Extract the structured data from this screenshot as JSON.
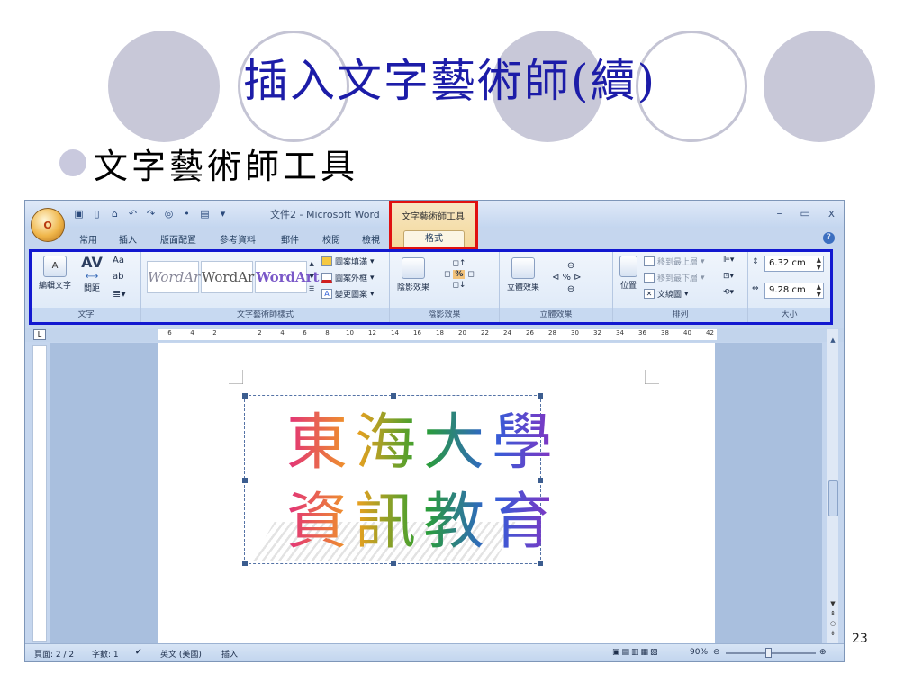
{
  "slide": {
    "title": "插入文字藝術師(續)",
    "bullet": "文字藝術師工具",
    "page_number": "23"
  },
  "window": {
    "doc_title": "文件2 - Microsoft Word",
    "context_group_title": "文字藝術師工具",
    "controls": {
      "minimize": "–",
      "maximize": "▭",
      "close": "x"
    },
    "office_button": "O"
  },
  "tabs": [
    "常用",
    "插入",
    "版面配置",
    "參考資料",
    "郵件",
    "校閱",
    "檢視"
  ],
  "active_tab": "格式",
  "ribbon": {
    "text_group": {
      "label": "文字",
      "edit_text": "編輯文字",
      "spacing": "間距",
      "av_icon": "AV",
      "aa_icon": "Aa",
      "ab_icon": "ab"
    },
    "styles_group": {
      "label": "文字藝術師樣式",
      "samples": [
        "WordArt",
        "WordArt",
        "WordArt"
      ],
      "fill": "圖案填滿",
      "outline": "圖案外框",
      "change_shape": "變更圖案"
    },
    "shadow_group": {
      "label": "陰影效果",
      "button": "陰影效果"
    },
    "threed_group": {
      "label": "立體效果",
      "button": "立體效果"
    },
    "arrange_group": {
      "label": "排列",
      "position": "位置",
      "bring_front": "移到最上層",
      "send_back": "移到最下層",
      "wrap": "文繞圖"
    },
    "size_group": {
      "label": "大小",
      "height": "6.32 cm",
      "width": "9.28 cm"
    }
  },
  "ruler_ticks": [
    "6",
    "4",
    "2",
    "",
    "2",
    "4",
    "6",
    "8",
    "10",
    "12",
    "14",
    "16",
    "18",
    "20",
    "22",
    "24",
    "26",
    "28",
    "30",
    "32",
    "34",
    "36",
    "38",
    "40",
    "42"
  ],
  "wordart": {
    "line1": "東海大學",
    "line2": "資訊教育"
  },
  "statusbar": {
    "page": "頁面: 2 / 2",
    "words": "字數: 1",
    "language": "英文 (美國)",
    "mode": "插入",
    "zoom": "90%"
  },
  "colors": {
    "accent_blue": "#1218d0",
    "highlight_red": "#e01010",
    "title_blue": "#1c1ca8"
  }
}
